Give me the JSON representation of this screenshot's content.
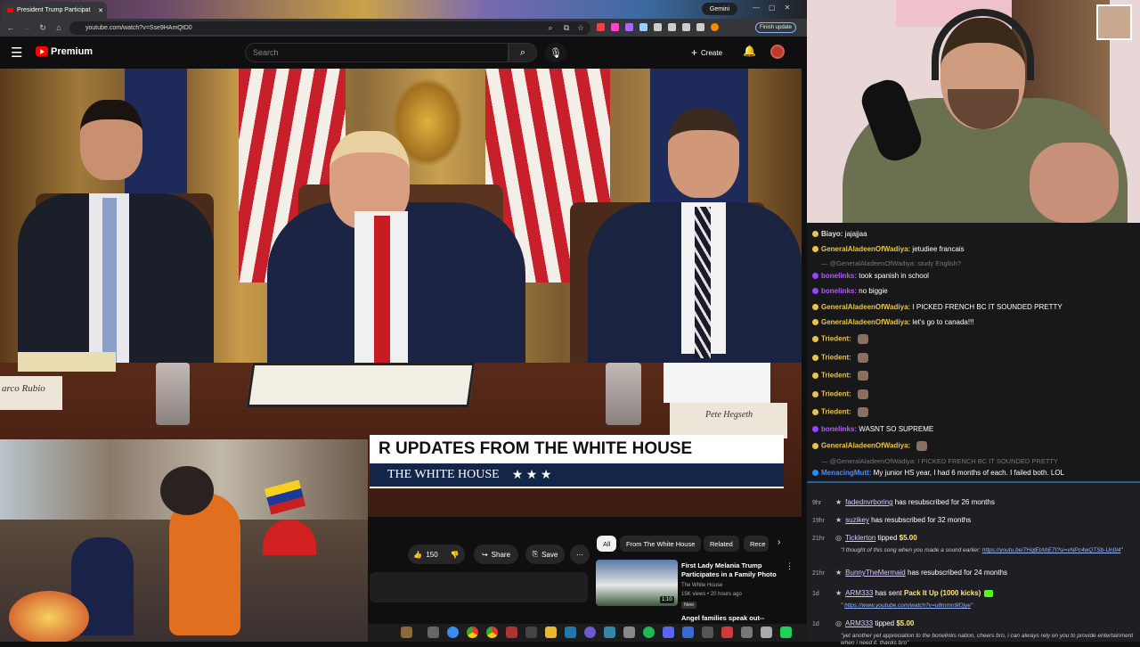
{
  "browser": {
    "tab_title": "President Trump Participat",
    "gemini_label": "Gemini",
    "url": "youtube.com/watch?v=Sse9HAmQtD0",
    "finish_update": "Finish update"
  },
  "youtube": {
    "brand": "Premium",
    "search_placeholder": "Search",
    "create_label": "Create"
  },
  "video": {
    "banner_headline": "R UPDATES FROM THE WHITE HOUSE",
    "banner_sub": "THE WHITE HOUSE",
    "banner_stars": "★ ★ ★",
    "nameplate_left": "arco Rubio",
    "nameplate_right": "Pete Hegseth"
  },
  "actions": {
    "like_count": "150",
    "share": "Share",
    "save": "Save"
  },
  "chips": [
    "All",
    "From The White House",
    "Related",
    "Rece"
  ],
  "related": {
    "title": "First Lady Melania Trump Participates in a Family Photo",
    "channel": "The White House",
    "meta": "15K views • 20 hours ago",
    "badge": "New",
    "duration": "1:10",
    "next_title": "Angel families speak out--"
  },
  "chat": [
    {
      "user": "Biayo",
      "msg": "jajajjaa",
      "color": "#e0e0e0"
    },
    {
      "user": "GeneralAladeenOfWadiya",
      "msg": "jetudiee francais",
      "color": "#e8c547"
    },
    {
      "quote": "@GeneralAladeenOfWadiya: study English?"
    },
    {
      "user": "bonelinks",
      "msg": "took spanish in school",
      "color": "#b45bff"
    },
    {
      "user": "bonelinks",
      "msg": "no biggie",
      "color": "#b45bff"
    },
    {
      "user": "GeneralAladeenOfWadiya",
      "msg": "I PICKED FRENCH BC IT SOUNDED PRETTY",
      "color": "#e8c547"
    },
    {
      "user": "GeneralAladeenOfWadiya",
      "msg": "let's go to canada!!!",
      "color": "#e8c547"
    },
    {
      "user": "Triedent",
      "msg": "",
      "color": "#e8c547"
    },
    {
      "user": "Triedent",
      "msg": "",
      "color": "#e8c547"
    },
    {
      "user": "Triedent",
      "msg": "",
      "color": "#e8c547"
    },
    {
      "user": "Triedent",
      "msg": "",
      "color": "#e8c547"
    },
    {
      "user": "Triedent",
      "msg": "",
      "color": "#e8c547"
    },
    {
      "user": "bonelinks",
      "msg": "WASNT SO SUPREME",
      "color": "#b45bff"
    },
    {
      "user": "GeneralAladeenOfWadiya",
      "msg": "",
      "color": "#e8c547"
    },
    {
      "quote": "@GeneralAladeenOfWadiya: I PICKED FRENCH BC IT SOUNDED PRETTY"
    },
    {
      "user": "MenacingMutt",
      "msg": "My junior HS year, I had 6 months of each. I failed both. LOL",
      "color": "#4f8df7"
    }
  ],
  "events": [
    {
      "time": "9hr",
      "user": "fadednvrboring",
      "text": "has resubscribed for 26 months"
    },
    {
      "time": "19hr",
      "user": "suzikey",
      "text": "has resubscribed for 32 months"
    },
    {
      "time": "21hr",
      "user": "Ticklerton",
      "text": "tipped",
      "amount": "$5.00",
      "sub": "\"I thought of this song when you made a sound earlier:",
      "link": "https://youtu.be/7HqlEtAhE7I?si=vNPc4wQTSb-Un0l4",
      "sub_end": "\""
    },
    {
      "time": "21hr",
      "user": "BunnyTheMermaid",
      "text": "has resubscribed for 24 months"
    },
    {
      "time": "1d",
      "user": "ARM333",
      "text": "has sent",
      "extra": "Pack It Up (1000 kicks)",
      "sub": "\"",
      "link": "https://www.youtube.com/watch?v=u8mmn9lOjye",
      "sub_end": "\""
    },
    {
      "time": "1d",
      "user": "ARM333",
      "text": "tipped",
      "amount": "$5.00",
      "sub": "\"yet another yet appreciation to the bonelinks nation, cheers bro, i can always rely on you to provide entertainment when i need it. thanks bro\"",
      "link": "",
      "sub_end": ""
    }
  ]
}
